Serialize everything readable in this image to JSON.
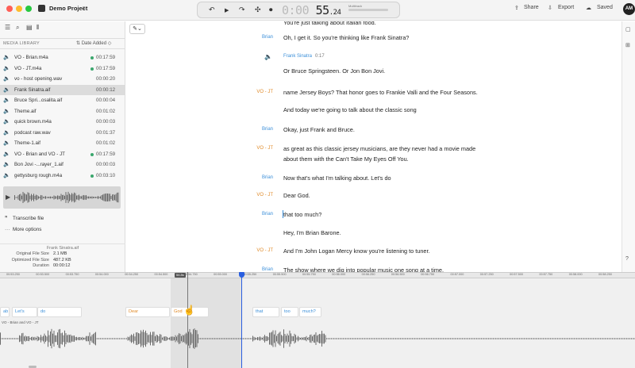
{
  "titlebar": {
    "project_title": "Demo Project",
    "project_chevron": "▾",
    "traffic_colors": [
      "#ff5f57",
      "#febc2e",
      "#28c840"
    ],
    "transport": {
      "rewind_icon": "↶",
      "play_icon": "▶",
      "forward_icon": "↷",
      "gap_icon": "✣",
      "mic_icon": "⏺",
      "time_dim": "0:00 ",
      "time_main": "55",
      "time_frac": ".24",
      "multitrack_label": "Multitrack"
    },
    "share_label": "Share",
    "export_label": "Export",
    "saved_label": "Saved",
    "avatar_initials": "AM"
  },
  "sidebar": {
    "tools": [
      "☰",
      "⌕",
      "▤",
      "⫴"
    ],
    "library_title": "MEDIA LIBRARY",
    "sort_label": "Date Added",
    "sort_icon": "⇅",
    "items": [
      {
        "name": "VO - Brian.m4a",
        "duration": "00:17:59",
        "dot": true,
        "selected": false
      },
      {
        "name": "VO - JT.m4a",
        "duration": "00:17:59",
        "dot": true,
        "selected": false
      },
      {
        "name": "vo - host opening.wav",
        "duration": "00:00:20",
        "dot": false,
        "selected": false
      },
      {
        "name": "Frank Sinatra.aif",
        "duration": "00:00:12",
        "dot": false,
        "selected": true
      },
      {
        "name": "Bruce Spri...osalita.aif",
        "duration": "00:00:04",
        "dot": false,
        "selected": false
      },
      {
        "name": "Theme.aif",
        "duration": "00:01:02",
        "dot": false,
        "selected": false
      },
      {
        "name": "quick brown.m4a",
        "duration": "00:00:03",
        "dot": false,
        "selected": false
      },
      {
        "name": "podcast raw.wav",
        "duration": "00:01:37",
        "dot": false,
        "selected": false
      },
      {
        "name": "Theme-1.aif",
        "duration": "00:01:02",
        "dot": false,
        "selected": false
      },
      {
        "name": "VO - Brian and VO - JT",
        "duration": "00:17:59",
        "dot": true,
        "selected": false
      },
      {
        "name": "Bon Jovi -...rayer_1.aif",
        "duration": "00:00:03",
        "dot": false,
        "selected": false
      },
      {
        "name": "gettysburg rough.m4a",
        "duration": "00:03:10",
        "dot": true,
        "selected": false
      }
    ],
    "transcribe_label": "Transcribe file",
    "more_options_label": "More options",
    "file_info": {
      "name": "Frank Sinatra.aif",
      "rows": [
        {
          "label": "Original File Size",
          "value": "2.1 MB"
        },
        {
          "label": "Optimized File Size",
          "value": "487.2 KB"
        },
        {
          "label": "Duration",
          "value": "00:00:12"
        }
      ]
    }
  },
  "transcript": {
    "edit_icon": "✎",
    "clip": {
      "name": "Frank Sinatra",
      "duration": "0:17",
      "icon": "🔈"
    },
    "rows": [
      {
        "speaker": "",
        "cls": "",
        "text": "You're just talking about Italian food."
      },
      {
        "speaker": "Brian",
        "cls": "brian",
        "text": "Oh, I get it. So you're thinking like Frank Sinatra?"
      },
      {
        "speaker": "",
        "cls": "",
        "text": "Or Bruce Springsteen. Or Jon Bon Jovi."
      },
      {
        "speaker": "VO - JT",
        "cls": "vojt",
        "text": "name Jersey Boys? That honor goes to Frankie Valli and the Four Seasons."
      },
      {
        "speaker": "",
        "cls": "",
        "text": "And today we're going to talk about the classic song"
      },
      {
        "speaker": "Brian",
        "cls": "brian",
        "text": "Okay, just Frank and Bruce."
      },
      {
        "speaker": "VO - JT",
        "cls": "vojt",
        "text": "as great as this classic jersey musicians, are they never had a movie made"
      },
      {
        "speaker": "",
        "cls": "",
        "text": "about them with the Can't Take My Eyes Off You."
      },
      {
        "speaker": "Brian",
        "cls": "brian",
        "text": "Now that's what I'm talking about. Let's do"
      },
      {
        "speaker": "VO - JT",
        "cls": "vojt",
        "text": "Dear God."
      },
      {
        "speaker": "Brian",
        "cls": "brian",
        "text": "that too much?"
      },
      {
        "speaker": "",
        "cls": "",
        "text": "Hey, I'm Brian Barone."
      },
      {
        "speaker": "VO - JT",
        "cls": "vojt",
        "text": "And I'm John Logan Mercy know you're listening to tuner."
      },
      {
        "speaker": "Brian",
        "cls": "brian",
        "text": "The show where we dig into popular music one song at a time."
      }
    ],
    "rightbar_icons": [
      "▢",
      "⊞",
      "?"
    ]
  },
  "timeline": {
    "ticks": [
      "00:53.250",
      "00:53.500",
      "00:53.750",
      "00:54.000",
      "00:54.250",
      "00:54.500",
      "00:54.750",
      "00:55.000",
      "00:55.250",
      "00:55.500",
      "00:55.750",
      "00:56.000",
      "00:56.250",
      "00:56.500",
      "00:56.750",
      "00:57.000",
      "00:57.250",
      "00:57.500",
      "00:57.750",
      "00:58.000",
      "00:58.250"
    ],
    "hover_time": "54.8s",
    "track_label": "VO - Brian and VO - JT",
    "words": [
      {
        "text": "ab",
        "cls": "brian"
      },
      {
        "text": "Let's",
        "cls": "brian"
      },
      {
        "text": "do",
        "cls": "brian"
      },
      {
        "text": "Dear",
        "cls": "vojt"
      },
      {
        "text": "God",
        "cls": "vojt"
      },
      {
        "text": "that",
        "cls": "brian"
      },
      {
        "text": "too",
        "cls": "brian"
      },
      {
        "text": "much?",
        "cls": "brian"
      }
    ]
  }
}
